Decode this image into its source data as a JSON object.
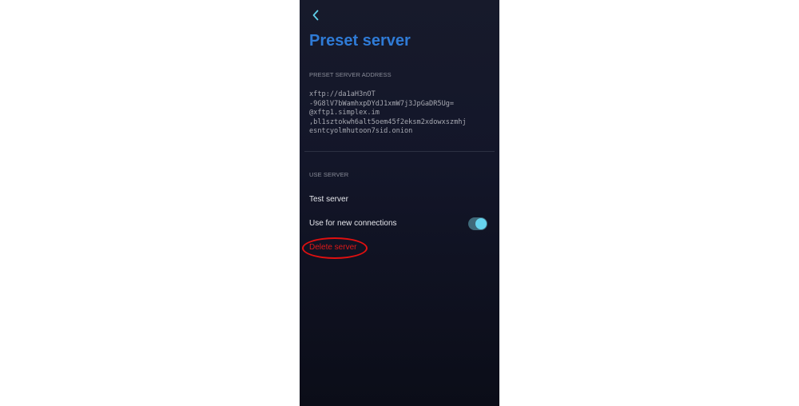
{
  "header": {
    "back_icon": "chevron-left-icon",
    "title": "Preset server"
  },
  "address_section": {
    "label": "PRESET SERVER ADDRESS",
    "lines": [
      "xftp://da1aH3nOT",
      "-9G8lV7bWamhxpDYdJ1xmW7j3JpGaDR5Ug=",
      "@xftp1.simplex.im",
      ",bl1sztokwh6alt5oem45f2eksm2xdowxszmhj",
      "esntcyolmhutoon7sid.onion"
    ]
  },
  "use_section": {
    "label": "USE SERVER",
    "test_label": "Test server",
    "use_new_label": "Use for new connections",
    "use_new_enabled": true,
    "delete_label": "Delete server"
  },
  "colors": {
    "title": "#2f7bd6",
    "toggle_on": "#66d4ee",
    "danger": "#e01a1a"
  }
}
